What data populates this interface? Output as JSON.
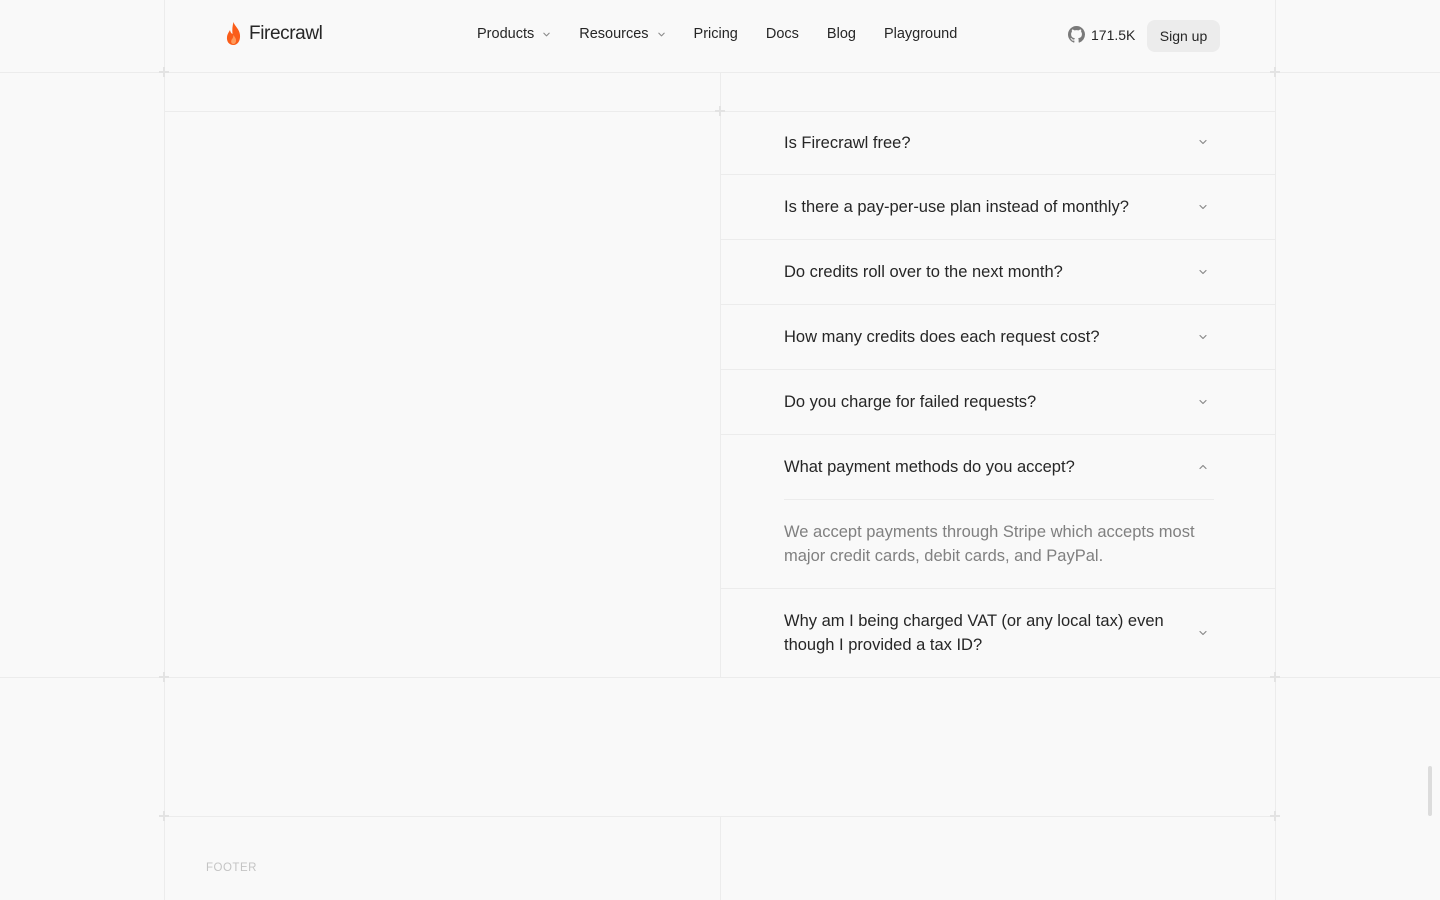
{
  "header": {
    "brand": "Firecrawl",
    "nav": [
      {
        "label": "Products",
        "has_dropdown": true
      },
      {
        "label": "Resources",
        "has_dropdown": true
      },
      {
        "label": "Pricing",
        "has_dropdown": false
      },
      {
        "label": "Docs",
        "has_dropdown": false
      },
      {
        "label": "Blog",
        "has_dropdown": false
      },
      {
        "label": "Playground",
        "has_dropdown": false
      }
    ],
    "github_stars": "171.5K",
    "signup_label": "Sign up"
  },
  "faq": {
    "items": [
      {
        "question": "Is Firecrawl free?",
        "expanded": false
      },
      {
        "question": "Is there a pay-per-use plan instead of monthly?",
        "expanded": false
      },
      {
        "question": "Do credits roll over to the next month?",
        "expanded": false
      },
      {
        "question": "How many credits does each request cost?",
        "expanded": false
      },
      {
        "question": "Do you charge for failed requests?",
        "expanded": false
      },
      {
        "question": "What payment methods do you accept?",
        "expanded": true,
        "answer": "We accept payments through Stripe which accepts most major credit cards, debit cards, and PayPal."
      },
      {
        "question": "Why am I being charged VAT (or any local tax) even though I provided a tax ID?",
        "expanded": false
      }
    ]
  },
  "footer": {
    "label": "FOOTER"
  },
  "colors": {
    "brand_flame": "#fa5d19",
    "background": "#f9f9f9",
    "grid_line": "#ececec"
  }
}
